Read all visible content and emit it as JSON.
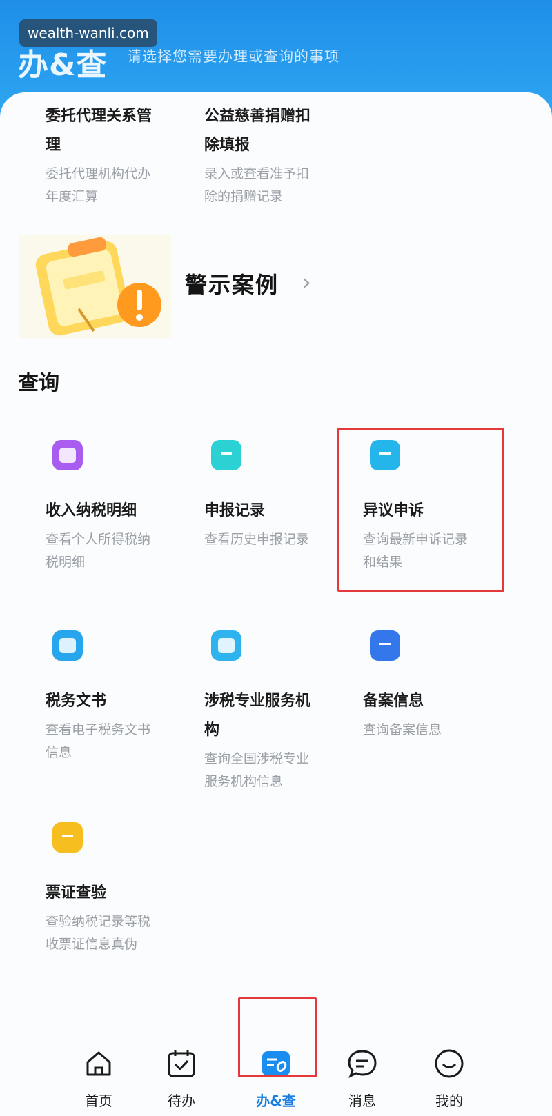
{
  "watermark": "wealth-wanli.com",
  "header": {
    "title": "办&查",
    "subtitle": "请选择您需要办理或查询的事项"
  },
  "top_tiles": [
    {
      "title_lines": [
        "委托代理关系管",
        "理"
      ],
      "desc_lines": [
        "委托代理机构代办",
        "年度汇算"
      ]
    },
    {
      "title_lines": [
        "公益慈善捐赠扣",
        "除填报"
      ],
      "desc_lines": [
        "录入或查看准予扣",
        "除的捐赠记录"
      ]
    }
  ],
  "warning": {
    "label": "警示案例",
    "chevron": "›"
  },
  "query_section": {
    "title": "查询",
    "tiles": [
      {
        "icon": "income-detail-icon",
        "color": "#a85cf0",
        "title_lines": [
          "收入纳税明细"
        ],
        "desc_lines": [
          "查看个人所得税纳",
          "税明细"
        ]
      },
      {
        "icon": "declaration-record-icon",
        "color": "#2bd1d3",
        "title_lines": [
          "申报记录"
        ],
        "desc_lines": [
          "查看历史申报记录"
        ]
      },
      {
        "icon": "appeal-icon",
        "color": "#24b6ea",
        "title_lines": [
          "异议申诉"
        ],
        "desc_lines": [
          "查询最新申诉记录",
          "和结果"
        ]
      },
      {
        "icon": "tax-document-icon",
        "color": "#27a6ee",
        "title_lines": [
          "税务文书"
        ],
        "desc_lines": [
          "查看电子税务文书",
          "信息"
        ]
      },
      {
        "icon": "tax-agency-icon",
        "color": "#2fb3ee",
        "title_lines": [
          "涉税专业服务机",
          "构"
        ],
        "desc_lines": [
          "查询全国涉税专业",
          "服务机构信息"
        ]
      },
      {
        "icon": "filing-info-icon",
        "color": "#3477ea",
        "title_lines": [
          "备案信息"
        ],
        "desc_lines": [
          "查询备案信息"
        ]
      },
      {
        "icon": "invoice-verify-icon",
        "color": "#f7be1f",
        "title_lines": [
          "票证查验"
        ],
        "desc_lines": [
          "查验纳税记录等税",
          "收票证信息真伪"
        ]
      }
    ]
  },
  "bottom_nav": [
    {
      "label": "首页",
      "icon": "home-icon"
    },
    {
      "label": "待办",
      "icon": "calendar-check-icon"
    },
    {
      "label": "办&查",
      "icon": "handle-query-icon",
      "active": true
    },
    {
      "label": "消息",
      "icon": "message-icon"
    },
    {
      "label": "我的",
      "icon": "smile-icon"
    }
  ],
  "colors": {
    "header_blue": "#1f8fe8",
    "active_blue": "#1a7fe0",
    "highlight_red": "#e5383b"
  }
}
